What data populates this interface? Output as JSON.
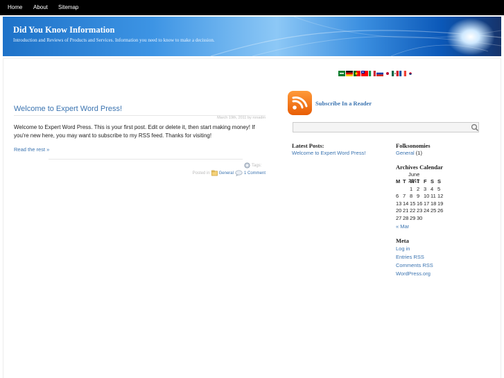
{
  "nav": {
    "home": "Home",
    "about": "About",
    "sitemap": "Sitemap"
  },
  "banner": {
    "title": "Did You Know Information",
    "description": "Introduction and Reviews of Products and Services. Information you need to know to make a decission."
  },
  "flags": [
    "arabic",
    "german",
    "portuguese",
    "chinese",
    "italian",
    "russian",
    "japanese",
    "spanish-mexico",
    "french",
    "korean"
  ],
  "post": {
    "title": "Welcome to Expert Word Press!",
    "date": "March 19th, 2011 by ronadm",
    "body": "Welcome to Expert Word Press. This is your first post. Edit or delete it, then start making money! If you're new here, you may want to subscribe to my RSS feed. Thanks for visiting!",
    "read_more": "Read the rest »",
    "tags_label": "Tags:",
    "posted_in": "Posted in",
    "category": "General",
    "comments": "1 Comment"
  },
  "sidebar": {
    "subscribe": "Subscribe In a Reader",
    "search_placeholder": "",
    "latest_title": "Latest Posts:",
    "latest_link": "Welcome to Expert Word Press!",
    "folk_title": "Folksonomies",
    "folk_link": "General",
    "folk_count": "(1)",
    "archives_title": "Archives Calendar",
    "calendar": {
      "caption": "June 2011",
      "headers": [
        "M",
        "T",
        "W",
        "T",
        "F",
        "S",
        "S"
      ],
      "rows": [
        [
          "",
          "",
          "1",
          "2",
          "3",
          "4",
          "5"
        ],
        [
          "6",
          "7",
          "8",
          "9",
          "10",
          "11",
          "12"
        ],
        [
          "13",
          "14",
          "15",
          "16",
          "17",
          "18",
          "19"
        ],
        [
          "20",
          "21",
          "22",
          "23",
          "24",
          "25",
          "26"
        ],
        [
          "27",
          "28",
          "29",
          "30",
          "",
          "",
          ""
        ]
      ],
      "prev": "« Mar"
    },
    "meta_title": "Meta",
    "meta_links": {
      "login": "Log in",
      "entries": "Entries RSS",
      "comments": "Comments RSS",
      "wordpress": "WordPress.org"
    }
  },
  "colors": {
    "link": "#3a73b0",
    "nav_bg": "#000000",
    "banner_start": "#1e72c8",
    "rss_orange": "#e85d05"
  }
}
